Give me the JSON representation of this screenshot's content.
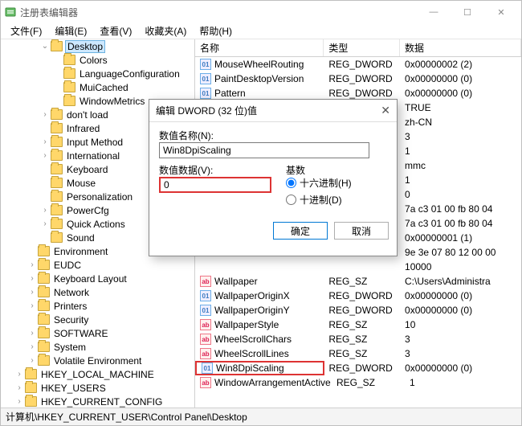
{
  "window": {
    "title": "注册表编辑器",
    "sys_min": "—",
    "sys_max": "☐",
    "sys_close": "✕"
  },
  "menu": [
    "文件(F)",
    "编辑(E)",
    "查看(V)",
    "收藏夹(A)",
    "帮助(H)"
  ],
  "tree": {
    "selected": "Desktop",
    "items": [
      {
        "label": "Desktop",
        "level": 3,
        "open": true,
        "selected": true
      },
      {
        "label": "Colors",
        "level": 4
      },
      {
        "label": "LanguageConfiguration",
        "level": 4
      },
      {
        "label": "MuiCached",
        "level": 4
      },
      {
        "label": "WindowMetrics",
        "level": 4
      },
      {
        "label": "don't load",
        "level": 3,
        "open": false
      },
      {
        "label": "Infrared",
        "level": 3
      },
      {
        "label": "Input Method",
        "level": 3,
        "open": false
      },
      {
        "label": "International",
        "level": 3,
        "open": false
      },
      {
        "label": "Keyboard",
        "level": 3
      },
      {
        "label": "Mouse",
        "level": 3
      },
      {
        "label": "Personalization",
        "level": 3
      },
      {
        "label": "PowerCfg",
        "level": 3,
        "open": false
      },
      {
        "label": "Quick Actions",
        "level": 3,
        "open": false
      },
      {
        "label": "Sound",
        "level": 3
      },
      {
        "label": "Environment",
        "level": 2
      },
      {
        "label": "EUDC",
        "level": 2,
        "open": false
      },
      {
        "label": "Keyboard Layout",
        "level": 2,
        "open": false
      },
      {
        "label": "Network",
        "level": 2,
        "open": false
      },
      {
        "label": "Printers",
        "level": 2,
        "open": false
      },
      {
        "label": "Security",
        "level": 2
      },
      {
        "label": "SOFTWARE",
        "level": 2,
        "open": false
      },
      {
        "label": "System",
        "level": 2,
        "open": false
      },
      {
        "label": "Volatile Environment",
        "level": 2,
        "open": false
      },
      {
        "label": "HKEY_LOCAL_MACHINE",
        "level": 1,
        "open": false
      },
      {
        "label": "HKEY_USERS",
        "level": 1,
        "open": false
      },
      {
        "label": "HKEY_CURRENT_CONFIG",
        "level": 1,
        "open": false
      }
    ]
  },
  "list": {
    "headers": [
      "名称",
      "类型",
      "数据"
    ],
    "rows": [
      {
        "icon": "bin",
        "name": "MouseWheelRouting",
        "type": "REG_DWORD",
        "data": "0x00000002 (2)"
      },
      {
        "icon": "bin",
        "name": "PaintDesktopVersion",
        "type": "REG_DWORD",
        "data": "0x00000000 (0)"
      },
      {
        "icon": "bin",
        "name": "Pattern",
        "type": "REG_DWORD",
        "data": "0x00000000 (0)"
      },
      {
        "icon": "hidden",
        "name": "",
        "type": "",
        "data": "TRUE"
      },
      {
        "icon": "hidden",
        "name": "",
        "type": "",
        "data": "zh-CN"
      },
      {
        "icon": "hidden",
        "name": "",
        "type": "",
        "data": "3"
      },
      {
        "icon": "hidden",
        "name": "",
        "type": "",
        "data": "1"
      },
      {
        "icon": "hidden",
        "name": "",
        "type": "",
        "data": "mmc"
      },
      {
        "icon": "hidden",
        "name": "",
        "type": "",
        "data": "1"
      },
      {
        "icon": "hidden",
        "name": "",
        "type": "",
        "data": "0"
      },
      {
        "icon": "hidden",
        "name": "",
        "type": "",
        "data": "7a c3 01 00 fb 80 04"
      },
      {
        "icon": "hidden",
        "name": "",
        "type": "",
        "data": "7a c3 01 00 fb 80 04"
      },
      {
        "icon": "hidden",
        "name": "",
        "type": "",
        "data": "0x00000001 (1)"
      },
      {
        "icon": "hidden",
        "name": "",
        "type": "",
        "data": "9e 3e 07 80 12 00 00"
      },
      {
        "icon": "hidden",
        "name": "",
        "type": "",
        "data": "10000"
      },
      {
        "icon": "str",
        "name": "Wallpaper",
        "type": "REG_SZ",
        "data": "C:\\Users\\Administra"
      },
      {
        "icon": "bin",
        "name": "WallpaperOriginX",
        "type": "REG_DWORD",
        "data": "0x00000000 (0)"
      },
      {
        "icon": "bin",
        "name": "WallpaperOriginY",
        "type": "REG_DWORD",
        "data": "0x00000000 (0)"
      },
      {
        "icon": "str",
        "name": "WallpaperStyle",
        "type": "REG_SZ",
        "data": "10"
      },
      {
        "icon": "str",
        "name": "WheelScrollChars",
        "type": "REG_SZ",
        "data": "3"
      },
      {
        "icon": "str",
        "name": "WheelScrollLines",
        "type": "REG_SZ",
        "data": "3"
      },
      {
        "icon": "bin",
        "name": "Win8DpiScaling",
        "type": "REG_DWORD",
        "data": "0x00000000 (0)",
        "highlight": true
      },
      {
        "icon": "str",
        "name": "WindowArrangementActive",
        "type": "REG_SZ",
        "data": "1"
      }
    ]
  },
  "dialog": {
    "title": "编辑 DWORD (32 位)值",
    "name_label": "数值名称(N):",
    "name_value": "Win8DpiScaling",
    "value_label": "数值数据(V):",
    "value_value": "0",
    "radix_label": "基数",
    "radio_hex": "十六进制(H)",
    "radio_dec": "十进制(D)",
    "ok": "确定",
    "cancel": "取消"
  },
  "statusbar": "计算机\\HKEY_CURRENT_USER\\Control Panel\\Desktop"
}
